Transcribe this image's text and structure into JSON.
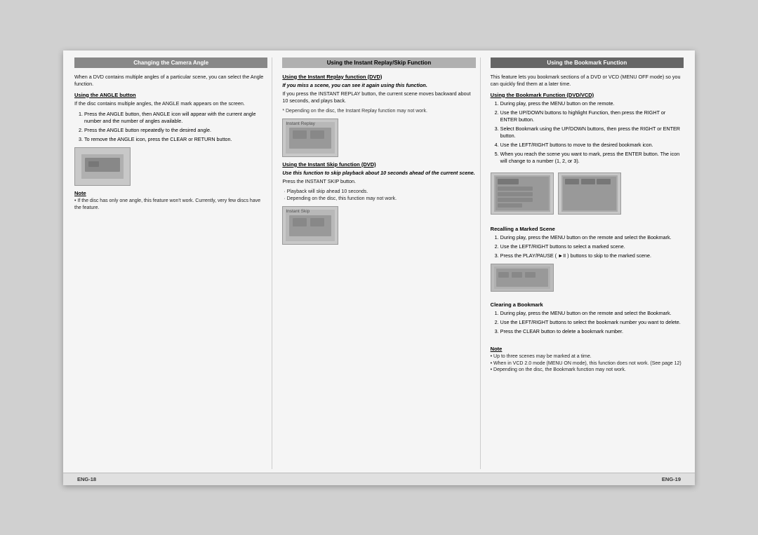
{
  "page": {
    "background": "#d0d0d0"
  },
  "col1": {
    "header": "Changing the Camera Angle",
    "intro": "When a DVD contains multiple angles of a particular scene, you can select the Angle function.",
    "angle_heading": "Using the ANGLE button",
    "angle_intro": "If the disc contains multiple angles, the ANGLE mark appears on the screen.",
    "steps": [
      "Press the ANGLE button, then ANGLE icon will appear with the current angle number and the number of angles available.",
      "Press the ANGLE button repeatedly to the desired angle.",
      "To remove the ANGLE icon, press the CLEAR or RETURN button."
    ],
    "note_label": "Note",
    "note_text": "• If the disc has only one angle, this feature won't work. Currently, very few discs have the feature."
  },
  "col2": {
    "header": "Using the Instant Replay/Skip Function",
    "replay_heading": "Using the Instant Replay function (DVD)",
    "replay_bold": "If you miss a scene, you can see it again using this function.",
    "replay_text": "If you press the INSTANT REPLAY button, the current scene moves backward about 10 seconds, and plays back.",
    "replay_note": "* Depending on the disc, the Instant Replay function may not work.",
    "replay_image_label": "Instant Replay",
    "skip_heading": "Using the Instant Skip function (DVD)",
    "skip_bold": "Use this function to skip playback about 10 seconds ahead of the current scene.",
    "skip_text": "Press the INSTANT SKIP button.",
    "skip_dash1": "· Playback will skip ahead 10 seconds.",
    "skip_dash2": "· Depending on the disc, this function may not work.",
    "skip_image_label": "Instant Skip"
  },
  "col3": {
    "header": "Using the Bookmark Function",
    "intro": "This feature lets you bookmark sections of a DVD or VCD (MENU OFF mode) so you can quickly find them at a later time.",
    "bookmark_heading": "Using the Bookmark Function (DVD/VCD)",
    "steps": [
      "During play, press the MENU button on the remote.",
      "Use the UP/DOWN buttons to highlight Function, then press the RIGHT or ENTER button.",
      "Select Bookmark using the UP/DOWN buttons, then press the RIGHT or ENTER button.",
      "Use the LEFT/RIGHT buttons to move to the desired bookmark icon.",
      "When you reach the scene you want to mark, press the ENTER button. The icon will change to a number (1, 2, or 3)."
    ],
    "recall_heading": "Recalling a Marked Scene",
    "recall_steps": [
      "During play, press the MENU button on the remote and select the Bookmark.",
      "Use the LEFT/RIGHT buttons to select a marked scene.",
      "Press the PLAY/PAUSE ( ►II ) buttons to skip to the marked scene."
    ],
    "clear_heading": "Clearing a Bookmark",
    "clear_steps": [
      "During play, press the MENU button on the remote and select the Bookmark.",
      "Use the LEFT/RIGHT buttons to select the bookmark number you want to delete.",
      "Press the CLEAR button to delete a bookmark number."
    ],
    "note_label": "Note",
    "note_bullets": [
      "• Up to three scenes may be marked at a time.",
      "• When in VCD 2.0 mode (MENU ON mode), this function does not work. (See page 12)",
      "• Depending on the disc, the Bookmark function may not work."
    ]
  },
  "footer": {
    "left": "ENG-18",
    "right": "ENG-19"
  }
}
